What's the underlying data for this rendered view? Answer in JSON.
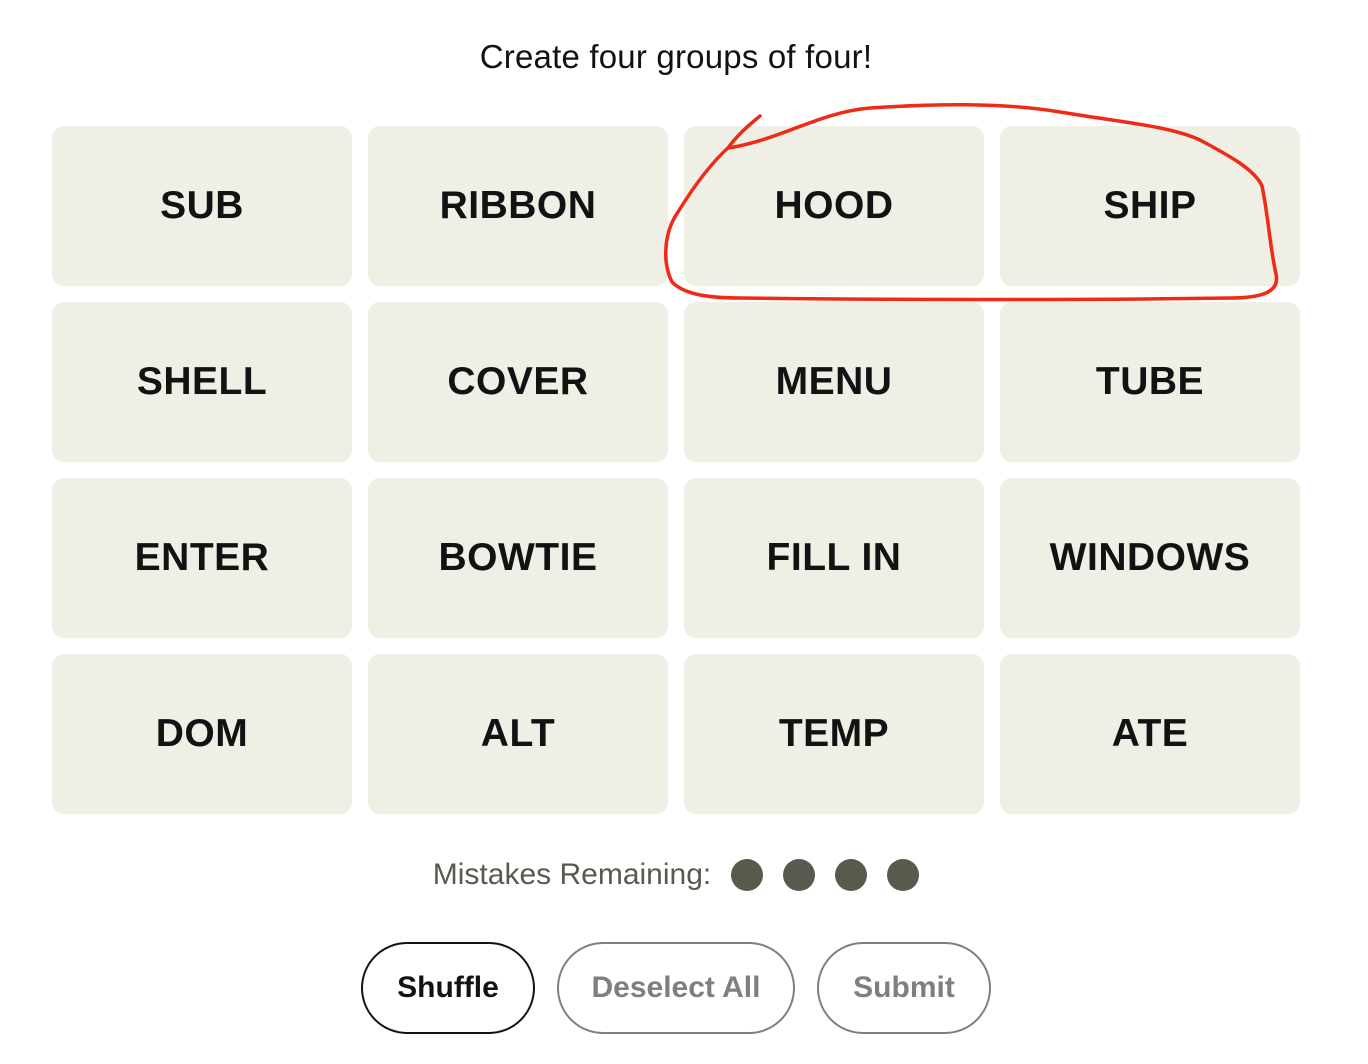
{
  "prompt": "Create four groups of four!",
  "tiles": [
    "SUB",
    "RIBBON",
    "HOOD",
    "SHIP",
    "SHELL",
    "COVER",
    "MENU",
    "TUBE",
    "ENTER",
    "BOWTIE",
    "FILL IN",
    "WINDOWS",
    "DOM",
    "ALT",
    "TEMP",
    "ATE"
  ],
  "mistakes": {
    "label": "Mistakes Remaining:",
    "remaining": 4,
    "dot_color": "#5a594e"
  },
  "controls": {
    "shuffle": "Shuffle",
    "deselect_all": "Deselect All",
    "submit": "Submit"
  },
  "colors": {
    "tile_bg": "#efefe6",
    "tile_text": "#121212",
    "annotation": "#f02a17"
  }
}
